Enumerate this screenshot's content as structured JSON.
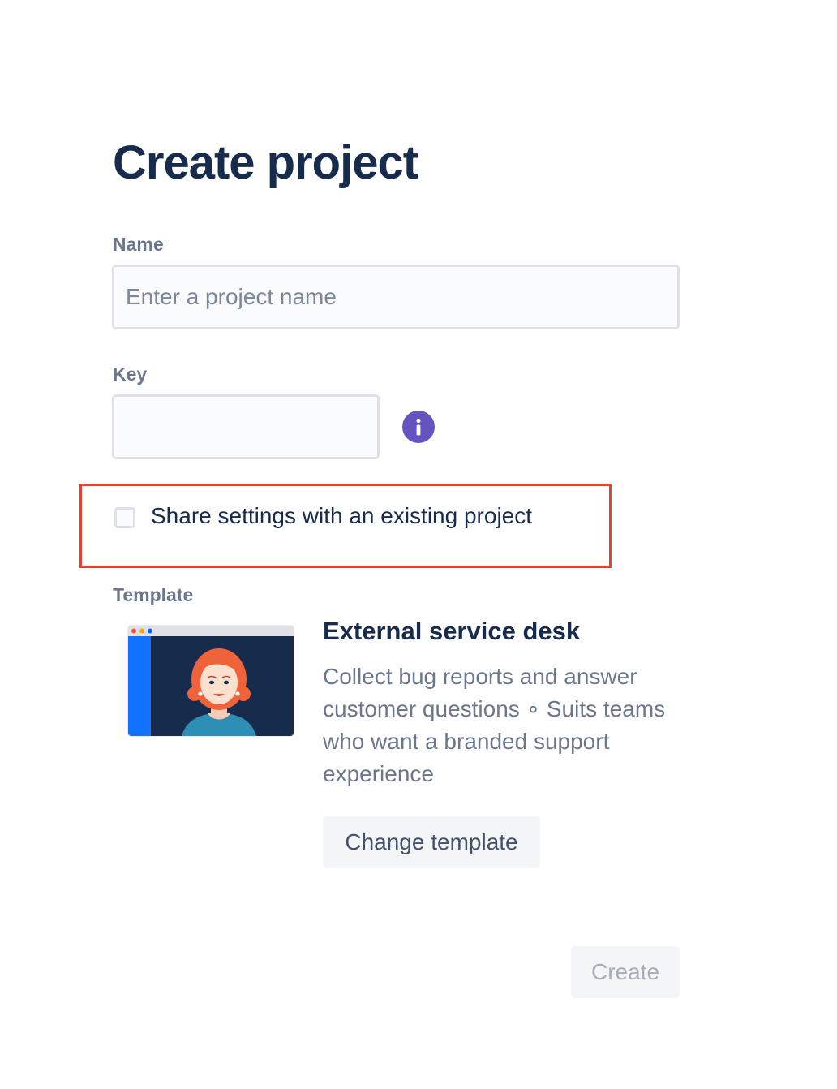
{
  "page": {
    "title": "Create project"
  },
  "form": {
    "name": {
      "label": "Name",
      "placeholder": "Enter a project name",
      "value": ""
    },
    "key": {
      "label": "Key",
      "value": "",
      "info_icon": "info-icon"
    },
    "share_settings": {
      "label": "Share settings with an existing project",
      "checked": false
    }
  },
  "template": {
    "label": "Template",
    "name": "External service desk",
    "description": "Collect bug reports and answer customer questions ∘ Suits teams who want a branded support experience",
    "change_label": "Change template",
    "thumbnail_icon": "service-desk-agent-illustration"
  },
  "actions": {
    "create_label": "Create",
    "create_enabled": false
  },
  "colors": {
    "title": "#172b4d",
    "label": "#6b778c",
    "info_icon": "#6554c0",
    "highlight": "#e2442f",
    "button_bg": "#f4f5f7"
  }
}
